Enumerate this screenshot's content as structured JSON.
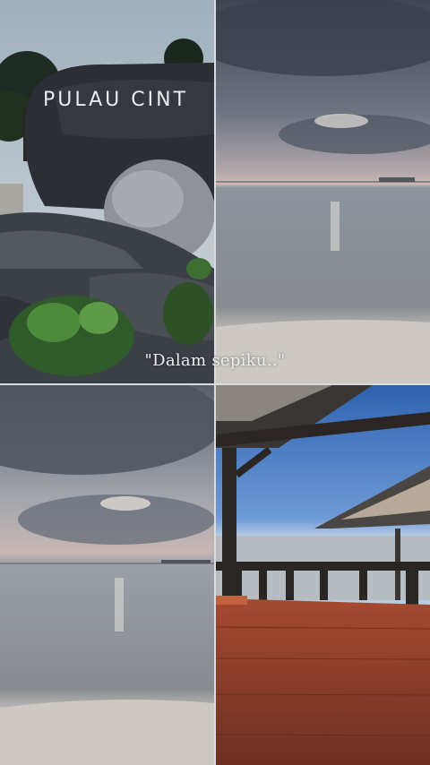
{
  "photo_grid": {
    "top_left": {
      "sign_text": "PULAU CINT"
    },
    "top_right": {},
    "bottom_left": {},
    "bottom_right": {}
  },
  "overlay": {
    "caption": "\"Dalam sepiku..\""
  },
  "colors": {
    "sky_grey": "#8e97a2",
    "sea_grey": "#8d9296",
    "sand": "#c9c6c0",
    "rock_dark": "#2a2d33",
    "wood_deck": "#8a3d2a",
    "sky_blue": "#3f77c2"
  }
}
